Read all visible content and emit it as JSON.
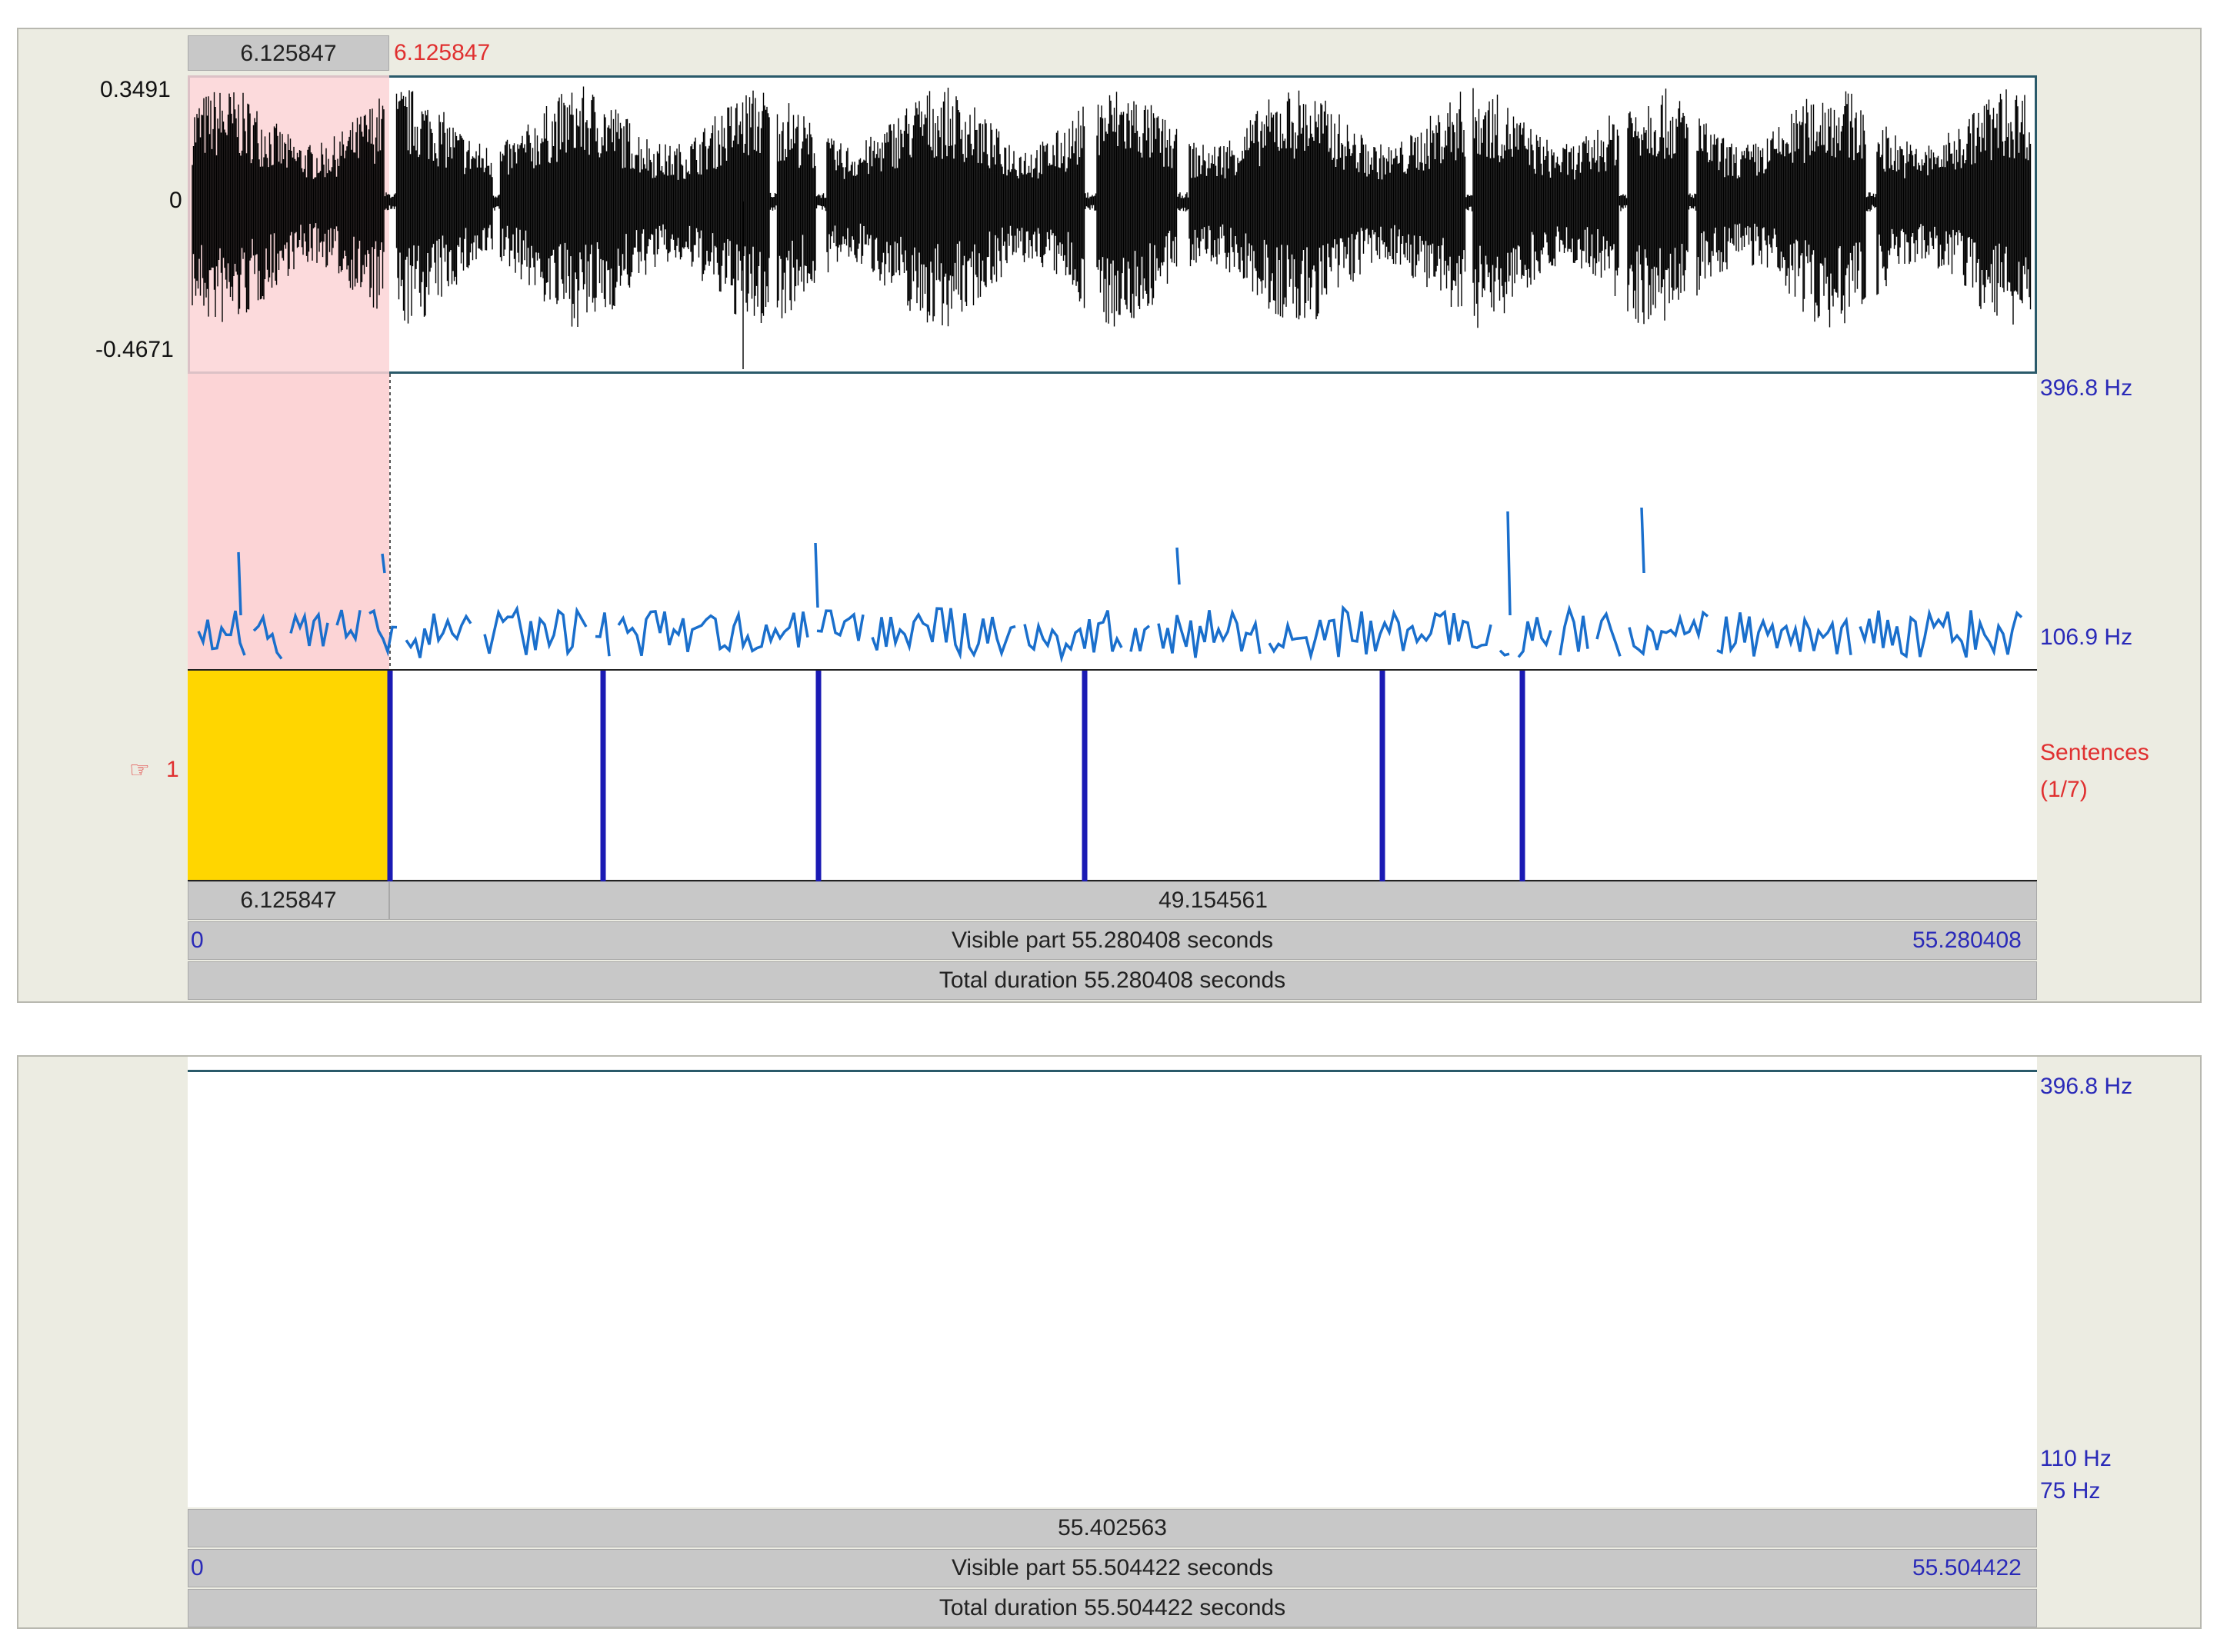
{
  "top_window": {
    "selection_top_label": "6.125847",
    "cursor_time_label": "6.125847",
    "amp_max": "0.3491",
    "amp_zero": "0",
    "amp_min": "-0.4671",
    "pitch_top": "396.8 Hz",
    "pitch_bottom": "106.9 Hz",
    "tier_number": "1",
    "tier_name": "Sentences",
    "tier_count": "(1/7)",
    "interval_first": "6.125847",
    "interval_second": "49.154561",
    "visible_start": "0",
    "visible_part": "Visible part 55.280408 seconds",
    "visible_end": "55.280408",
    "total_duration": "Total duration 55.280408 seconds"
  },
  "bottom_window": {
    "pitch_top": "396.8 Hz",
    "pitch_mid": "110 Hz",
    "pitch_bottom": "75 Hz",
    "interval": "55.402563",
    "visible_start": "0",
    "visible_part": "Visible part 55.504422 seconds",
    "visible_end": "55.504422",
    "total_duration": "Total duration 55.504422 seconds"
  },
  "colors": {
    "selection": "#fcd4d6",
    "waveform": "#000000",
    "pitch": "#1a6fcc",
    "tier_selected": "#ffd600",
    "boundary": "#1a1ab4"
  }
}
